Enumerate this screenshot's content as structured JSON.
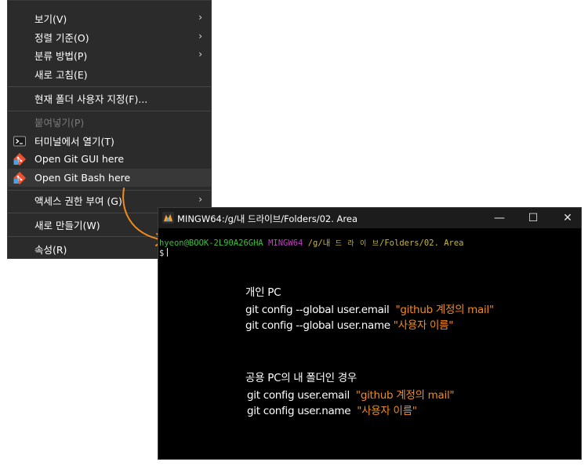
{
  "context_menu": {
    "items": [
      {
        "label": "보기(V)",
        "submenu": true
      },
      {
        "label": "정렬 기준(O)",
        "submenu": true
      },
      {
        "label": "분류 방법(P)",
        "submenu": true
      },
      {
        "label": "새로 고침(E)"
      },
      {
        "label": "현재 폴더 사용자 지정(F)..."
      },
      {
        "label": "붙여넣기(P)",
        "disabled": true
      },
      {
        "label": "터미널에서 열기(T)",
        "icon": "terminal-icon"
      },
      {
        "label": "Open Git GUI here",
        "icon": "git-icon"
      },
      {
        "label": "Open Git Bash here",
        "icon": "git-icon",
        "highlighted": true
      },
      {
        "label": "액세스 권한 부여 (G)",
        "submenu": true
      },
      {
        "label": "새로 만들기(W)",
        "submenu": true
      },
      {
        "label": "속성(R)"
      }
    ]
  },
  "terminal": {
    "title": "MINGW64:/g/내 드라이브/Folders/02. Area",
    "controls": {
      "minimize": "—",
      "maximize": "☐",
      "close": "✕"
    },
    "prompt": {
      "user_host": "hyeon@BOOK-2L90A26GHA",
      "env": "MINGW64",
      "path_prefix": "/g/내 ",
      "path_korean": "드 라 이 브",
      "path_suffix": "/Folders/02. Area",
      "symbol": "$"
    }
  },
  "notes": {
    "personal": {
      "heading": "개인 PC",
      "line1_cmd": "git config --global user.email",
      "line1_val": "\"github 계정의 mail\"",
      "line2_cmd": "git config --global user.name",
      "line2_val": "\"사용자 이름\""
    },
    "shared": {
      "heading": "공용 PC의 내 폴더인 경우",
      "line1_cmd": "git config user.email",
      "line1_val": "\"github 계정의 mail\"",
      "line2_cmd": "git config user.name",
      "line2_val": "\"사용자 이름\""
    }
  },
  "colors": {
    "accent_arrow": "#f08c1e",
    "prompt_green": "#3fbf3f",
    "prompt_magenta": "#c040c0",
    "prompt_yellow": "#c9b836"
  }
}
